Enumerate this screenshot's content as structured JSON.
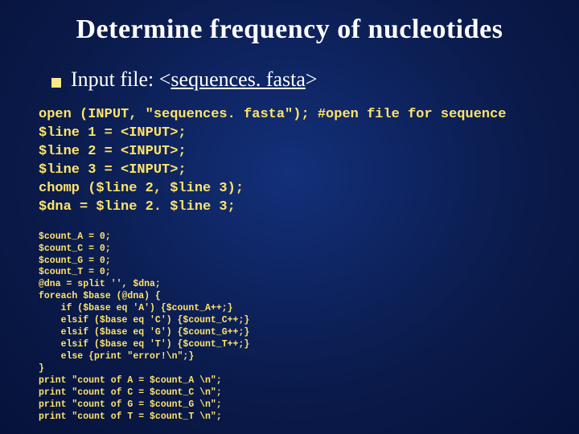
{
  "title": "Determine frequency of nucleotides",
  "bullet": {
    "prefix": "Input file: <",
    "link": "sequences. fasta",
    "suffix": ">"
  },
  "code_block_1": "open (INPUT, \"sequences. fasta\"); #open file for sequence\n$line 1 = <INPUT>;\n$line 2 = <INPUT>;\n$line 3 = <INPUT>;\nchomp ($line 2, $line 3);\n$dna = $line 2. $line 3;",
  "code_block_2": "$count_A = 0;\n$count_C = 0;\n$count_G = 0;\n$count_T = 0;\n@dna = split '', $dna;\nforeach $base (@dna) {\n    if ($base eq 'A') {$count_A++;}\n    elsif ($base eq 'C') {$count_C++;}\n    elsif ($base eq 'G') {$count_G++;}\n    elsif ($base eq 'T') {$count_T++;}\n    else {print \"error!\\n\";}\n}\nprint \"count of A = $count_A \\n\";\nprint \"count of C = $count_C \\n\";\nprint \"count of G = $count_G \\n\";\nprint \"count of T = $count_T \\n\";"
}
